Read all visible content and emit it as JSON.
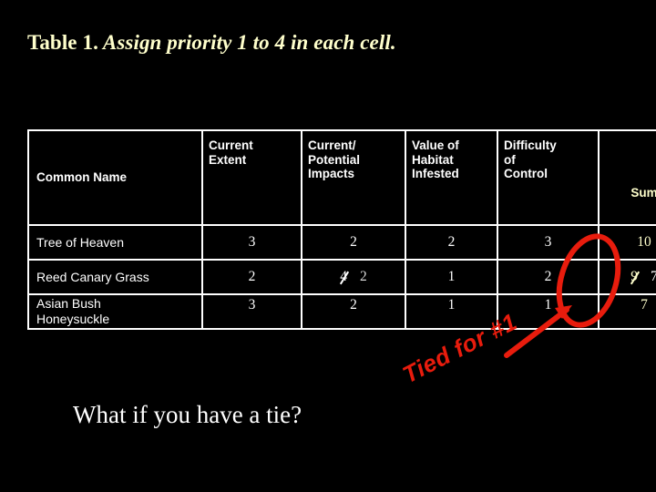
{
  "slide": {
    "background_color": "#000000",
    "title_label": "Table 1.",
    "title_rest": " Assign priority 1 to 4 in each cell.",
    "title_color": "#ffffcc",
    "bottom_question": "What if you have a tie?",
    "bottom_question_color": "#ffffff"
  },
  "table": {
    "border_color": "#ffffff",
    "headers": [
      "Common Name",
      "Current Extent",
      "Current/ Potential Impacts",
      "Value of Habitat Infested",
      "Difficulty of Control",
      "Sum"
    ],
    "header_lines": {
      "common_name": "Common Name",
      "current_extent": [
        "Current",
        "Extent"
      ],
      "current_potential_impacts": [
        "Current/",
        "Potential",
        "Impacts"
      ],
      "value_of_habitat_infested": [
        "Value of",
        "Habitat",
        "Infested"
      ],
      "difficulty_of_control": [
        "Difficulty",
        "of",
        "Control"
      ],
      "sum": "Sum"
    },
    "sum_header_color": "#ffffcc",
    "rows": [
      {
        "name": "Tree of Heaven",
        "name_line2": "",
        "current_extent": "3",
        "impacts": "2",
        "impacts_edited": "",
        "habitat_value": "2",
        "difficulty": "3",
        "sum": "10",
        "sum_edited": ""
      },
      {
        "name": "Reed Canary Grass",
        "name_line2": "",
        "current_extent": "2",
        "impacts": "4",
        "impacts_edited": "2",
        "habitat_value": "1",
        "difficulty": "2",
        "sum": "9",
        "sum_edited": "7"
      },
      {
        "name": "Asian Bush",
        "name_line2": "Honeysuckle",
        "current_extent": "3",
        "impacts": "2",
        "impacts_edited": "",
        "habitat_value": "1",
        "difficulty": "1",
        "sum": "7",
        "sum_edited": ""
      }
    ]
  },
  "annotations": {
    "tied_label": "Tied for #1",
    "annotation_color": "#e81c0d",
    "ellipse_target": "sum-column-ties",
    "arrow_points_to": "circled-sums"
  }
}
